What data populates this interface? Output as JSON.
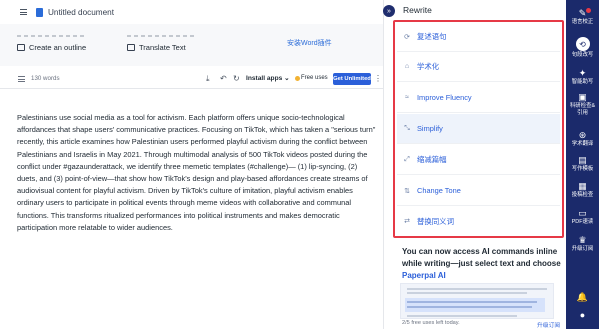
{
  "document": {
    "title": "Untitled document"
  },
  "tool_cards": [
    {
      "icon": "outline-icon",
      "label": "Create an outline"
    },
    {
      "icon": "translate-icon",
      "label": "Translate Text"
    }
  ],
  "word_plugin_link": "安装Word插件",
  "editor_toolbar": {
    "word_count": "130 words",
    "install_apps": "Install apps",
    "free_uses": "Free uses",
    "get_unlimited": "Get Unlimited"
  },
  "body_text": "Palestinians use social media as a tool for activism. Each platform offers unique socio-technological affordances that shape users' communicative practices. Focusing on TikTok, which has taken a \"serious turn\" recently, this article examines how Palestinian users performed playful activism during the conflict between Palestinians and Israelis in May 2021. Through multimodal analysis of 500 TikTok videos posted during the conflict under #gazaunderattack, we identify three memetic templates (#challenge)— (1) lip-syncing, (2) duets, and (3) point-of-view—that show how TikTok's design and play-based affordances create streams of audiovisual content for playful activism. Driven by TikTok's culture of imitation, playful activism enables ordinary users to participate in political events through meme videos with collaborative and communal functions. This transforms ritualized performances into political instruments and makes democratic participation more relatable to wider audiences.",
  "rewrite_panel": {
    "title": "Rewrite",
    "options": [
      {
        "label": "复述语句",
        "icon": "rephrase-icon"
      },
      {
        "label": "学术化",
        "icon": "academic-icon"
      },
      {
        "label": "Improve Fluency",
        "icon": "fluency-icon"
      },
      {
        "label": "Simplify",
        "icon": "simplify-icon"
      },
      {
        "label": "缩减篇幅",
        "icon": "shorten-icon"
      },
      {
        "label": "Change Tone",
        "icon": "tone-icon"
      },
      {
        "label": "替换同义词",
        "icon": "synonym-icon"
      }
    ],
    "active_option": "Simplify",
    "promo_text": "You can now access AI commands inline while writing—just select text and choose ",
    "promo_brand": "Paperpal AI",
    "uses_left": "2/5 free uses left today.",
    "upgrade_label": "升级订阅"
  },
  "sidebar": {
    "items": [
      {
        "label": "语言校正",
        "icon": "pen-icon"
      },
      {
        "label": "句段改写",
        "icon": "rewrite-icon"
      },
      {
        "label": "智能助写",
        "icon": "assistant-icon"
      },
      {
        "label": "科研检查&引用",
        "icon": "citation-icon"
      },
      {
        "label": "学术翻译",
        "icon": "translate-icon"
      },
      {
        "label": "写作模板",
        "icon": "template-icon"
      },
      {
        "label": "投稿检查",
        "icon": "submission-icon"
      },
      {
        "label": "PDF速读",
        "icon": "pdf-icon"
      },
      {
        "label": "升级订阅",
        "icon": "crown-icon"
      }
    ],
    "active_item": "句段改写",
    "colors": {
      "background": "#1b2a6b",
      "highlight_border": "#e63946",
      "accent": "#2b5fd9"
    }
  }
}
